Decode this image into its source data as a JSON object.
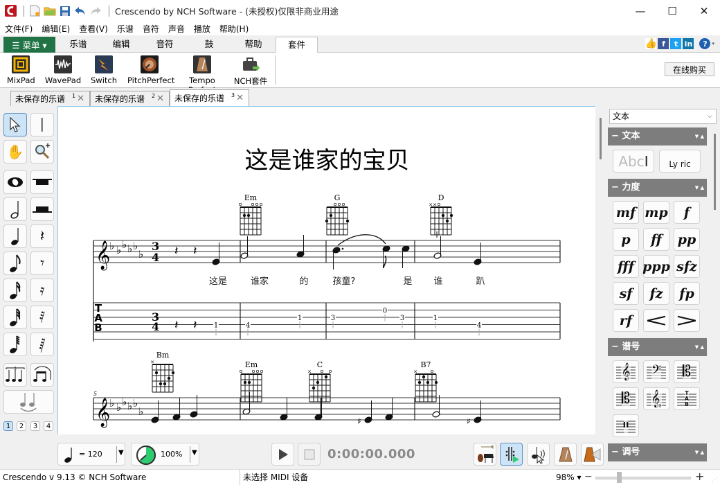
{
  "window": {
    "title": "Crescendo by NCH Software - (未授权)仅限非商业用途",
    "controls": {
      "minimize": "—",
      "maximize": "☐",
      "close": "✕"
    }
  },
  "menubar": [
    "文件(F)",
    "编辑(E)",
    "查看(V)",
    "乐谱",
    "音符",
    "声音",
    "播放",
    "帮助(H)"
  ],
  "ribbon_tabs": {
    "menu_button": "☰ 菜单 ▾",
    "tabs": [
      "乐谱",
      "编辑",
      "音符",
      "鼓",
      "帮助",
      "套件"
    ],
    "active": "套件"
  },
  "ribbon": {
    "items": [
      {
        "label": "MixPad",
        "icon": "mixpad-icon"
      },
      {
        "label": "WavePad",
        "icon": "wavepad-icon"
      },
      {
        "label": "Switch",
        "icon": "switch-icon"
      },
      {
        "label": "PitchPerfect",
        "icon": "pitchperfect-icon"
      },
      {
        "label": "Tempo Perfect",
        "icon": "metronome-icon"
      },
      {
        "label": "NCH套件",
        "icon": "toolbox-icon"
      }
    ],
    "buy_button": "在线购买"
  },
  "doc_tabs": [
    {
      "label": "未保存的乐谱",
      "num": "1"
    },
    {
      "label": "未保存的乐谱",
      "num": "2"
    },
    {
      "label": "未保存的乐谱",
      "num": "3",
      "active": true
    }
  ],
  "toolbox": {
    "pages": [
      "1",
      "2",
      "3",
      "4"
    ],
    "selected_page": "1"
  },
  "score": {
    "title": "这是谁家的宝贝",
    "system1": {
      "chords": [
        "Em",
        "G",
        "D"
      ],
      "time_signature": [
        "3",
        "4"
      ],
      "lyrics": [
        "这是",
        "谁家",
        "的",
        "孩童?",
        "是",
        "谁",
        "趴"
      ],
      "tab_label": [
        "T",
        "A",
        "B"
      ],
      "tab_numbers": [
        "1",
        "4",
        "1",
        "3",
        "0",
        "3",
        "1",
        "4"
      ]
    },
    "system2": {
      "measure_number": "5",
      "chords": [
        "Bm",
        "Em",
        "C",
        "B7"
      ]
    }
  },
  "right_panel": {
    "combo_value": "文本",
    "sections": [
      {
        "title": "文本",
        "items": [
          "Abc",
          "Ly ric"
        ]
      },
      {
        "title": "力度",
        "items": [
          "mf",
          "mp",
          "f",
          "p",
          "ff",
          "pp",
          "fff",
          "ppp",
          "sfz",
          "sf",
          "fz",
          "fp",
          "rf",
          "<",
          ">"
        ]
      },
      {
        "title": "谱号",
        "items": [
          "treble-clef",
          "bass-clef",
          "alto-clef",
          "tenor-clef",
          "treble-8vb-clef",
          "tab-clef",
          "percussion-clef"
        ]
      },
      {
        "title": "调号",
        "items": []
      }
    ]
  },
  "transport": {
    "tempo": "= 120",
    "volume": "100%",
    "time": "0:00:00.000"
  },
  "statusbar": {
    "version": "Crescendo v 9.13 © NCH Software",
    "midi": "未选择 MIDI 设备",
    "zoom": "98% ▾",
    "zoom_minus": "−",
    "zoom_plus": "+"
  },
  "colors": {
    "menu_green": "#217346",
    "selected_blue": "#cde4f7",
    "section_gray": "#7d7d7d",
    "volume_green": "#2ecc71"
  }
}
